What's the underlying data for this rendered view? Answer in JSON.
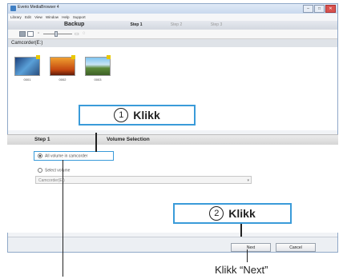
{
  "window": {
    "title": "Everio MediaBrowser 4",
    "menu": [
      "Library",
      "Edit",
      "View",
      "Window",
      "Help",
      "Support"
    ],
    "header_label": "Backup",
    "steps": [
      "Step 1",
      "Step 2",
      "Step 3"
    ],
    "active_step": "Step 1"
  },
  "source": {
    "label": "Camcorder(E:)",
    "thumbnails": [
      {
        "caption": "0001",
        "icon": "sports-scene"
      },
      {
        "caption": "0002",
        "icon": "airplane-sunset"
      },
      {
        "caption": "0003",
        "icon": "landscape"
      }
    ]
  },
  "panel": {
    "step_label": "Step 1",
    "section_title": "Volume Selection",
    "options": [
      {
        "label": "All volume in camcorder",
        "selected": true
      },
      {
        "label": "Select volume",
        "selected": false
      }
    ],
    "dropdown_value": "Camcorder(E:)"
  },
  "buttons": {
    "next": "Next",
    "cancel": "Cancel"
  },
  "callouts": {
    "c1": {
      "num": "1",
      "text": "Klikk"
    },
    "c2": {
      "num": "2",
      "text": "Klikk"
    },
    "next_caption": "Klikk “Next”"
  },
  "colors": {
    "accent": "#3a9bd9",
    "flag": "#e8c800"
  }
}
